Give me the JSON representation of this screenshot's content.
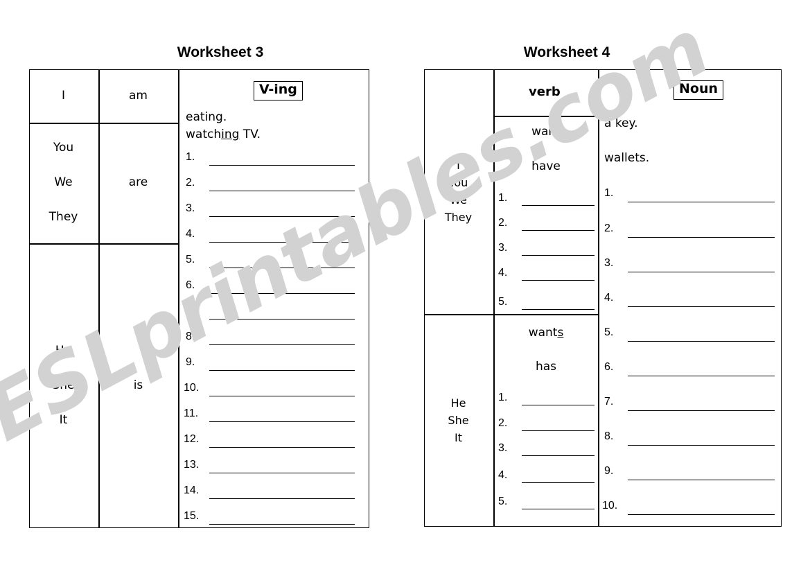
{
  "watermark": {
    "text": "ESLprintables.com",
    "color": "#d2d2d2"
  },
  "worksheet3": {
    "title": "Worksheet 3",
    "column_header": "V-ing",
    "rows": [
      {
        "pronouns": [
          "I"
        ],
        "be_verb": "am"
      },
      {
        "pronouns": [
          "You",
          "We",
          "They"
        ],
        "be_verb": "are"
      },
      {
        "pronouns": [
          "He",
          "She",
          "It"
        ],
        "be_verb": "is"
      }
    ],
    "examples": [
      {
        "prefix": "eating.",
        "underlined": "",
        "suffix": ""
      },
      {
        "prefix": "watch",
        "underlined": "ing",
        "suffix": " TV."
      }
    ],
    "answer_numbers": [
      "1.",
      "2.",
      "3.",
      "4.",
      "5.",
      "6.",
      "7.",
      "8.",
      "9.",
      "10.",
      "11.",
      "12.",
      "13.",
      "14.",
      "15."
    ]
  },
  "worksheet4": {
    "title": "Worksheet 4",
    "verb_column_header": "verb",
    "noun_column_header": "Noun",
    "rows": [
      {
        "pronouns": [
          "I",
          "You",
          "We",
          "They"
        ],
        "verbs": [
          {
            "prefix": "want",
            "underlined": "",
            "suffix": ""
          },
          {
            "prefix": "have",
            "underlined": "",
            "suffix": ""
          }
        ],
        "answer_numbers": [
          "1.",
          "2.",
          "3.",
          "4.",
          "5."
        ]
      },
      {
        "pronouns": [
          "He",
          "She",
          "It"
        ],
        "verbs": [
          {
            "prefix": "want",
            "underlined": "s",
            "suffix": ""
          },
          {
            "prefix": "has",
            "underlined": "",
            "suffix": ""
          }
        ],
        "answer_numbers": [
          "1.",
          "2.",
          "3.",
          "4.",
          "5."
        ]
      }
    ],
    "noun_examples": [
      "a key.",
      "wallets."
    ],
    "noun_answer_numbers": [
      "1.",
      "2.",
      "3.",
      "4.",
      "5.",
      "6.",
      "7.",
      "8.",
      "9.",
      "10."
    ]
  }
}
